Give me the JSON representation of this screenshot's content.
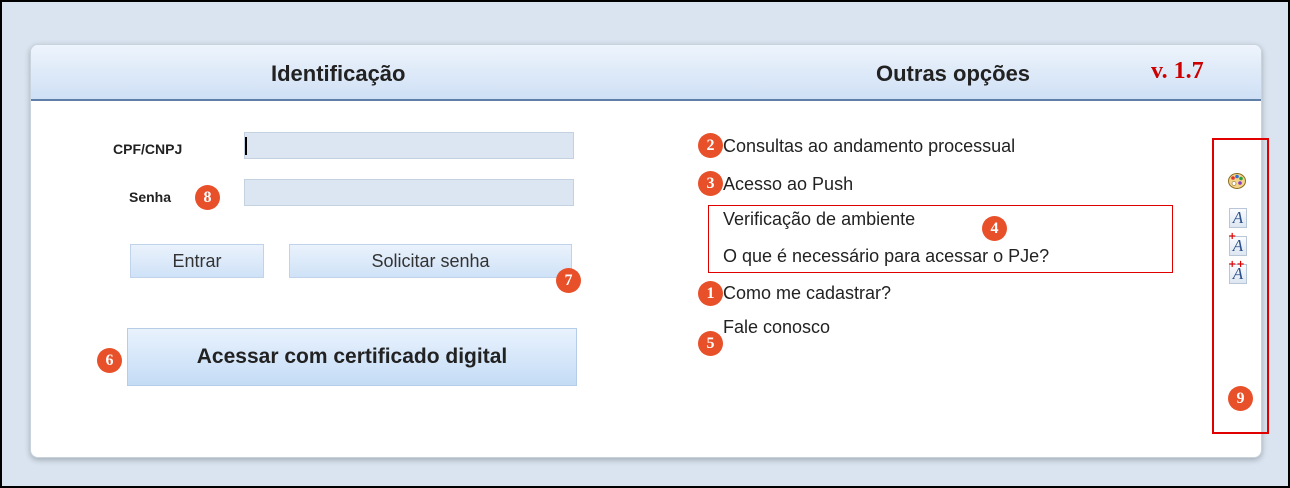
{
  "header": {
    "identificacao_title": "Identificação",
    "outras_title": "Outras opções",
    "version": "v. 1.7"
  },
  "login": {
    "cpf_label": "CPF/CNPJ",
    "cpf_value": "",
    "senha_label": "Senha",
    "senha_value": "",
    "entrar_label": "Entrar",
    "solicitar_label": "Solicitar senha",
    "certificado_label": "Acessar com certificado digital"
  },
  "options": {
    "consultas": "Consultas ao andamento processual",
    "push": "Acesso ao Push",
    "verificacao": "Verificação de ambiente",
    "necessario": "O que é necessário para acessar o PJe?",
    "cadastrar": "Como me cadastrar?",
    "fale": "Fale conosco"
  },
  "badges": {
    "b1": "1",
    "b2": "2",
    "b3": "3",
    "b4": "4",
    "b5": "5",
    "b6": "6",
    "b7": "7",
    "b8": "8",
    "b9": "9"
  },
  "side_toolbar": {
    "icons": [
      "palette-icon",
      "font-size-normal-icon",
      "font-size-increase-icon",
      "font-size-increase-more-icon"
    ]
  },
  "colors": {
    "badge": "#e8502a",
    "annotation_box": "#e00000",
    "version": "#cc0000",
    "header_border": "#5f7fa8"
  }
}
